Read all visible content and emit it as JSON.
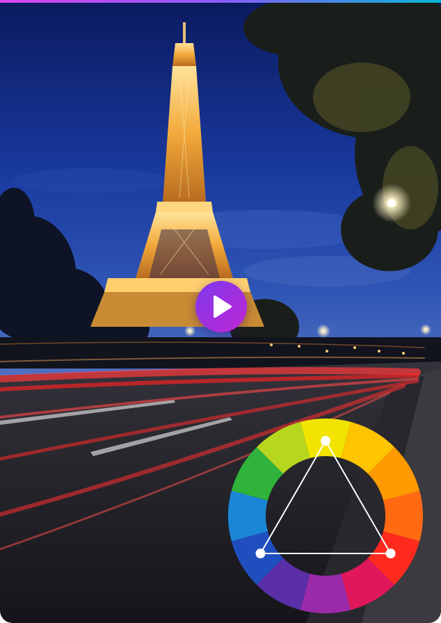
{
  "colors": {
    "topbar_gradient": [
      "#d946ef",
      "#8b5cf6",
      "#06b6d4"
    ],
    "play_gradient": [
      "#7c3aed",
      "#c026d3"
    ],
    "play_icon": "#ffffff",
    "sky_top": "#0b1f6b",
    "sky_mid": "#1d3fa6",
    "sky_horizon": "#3a5bb8",
    "tower_glow": "#f3b44a",
    "road": "#1c1d24",
    "light_trail": "#ff2a2a"
  },
  "icons": {
    "play": "play-icon",
    "scheme": "triad-icon"
  },
  "color_wheel": {
    "segments": [
      "#f2e400",
      "#ffc400",
      "#ff9a00",
      "#ff6a13",
      "#ff2a1e",
      "#e0175a",
      "#9a2aa8",
      "#5a2fa8",
      "#1f4fbf",
      "#1b86d6",
      "#2fb33a",
      "#b7d61e"
    ],
    "triad_markers": [
      0,
      4,
      8
    ]
  }
}
